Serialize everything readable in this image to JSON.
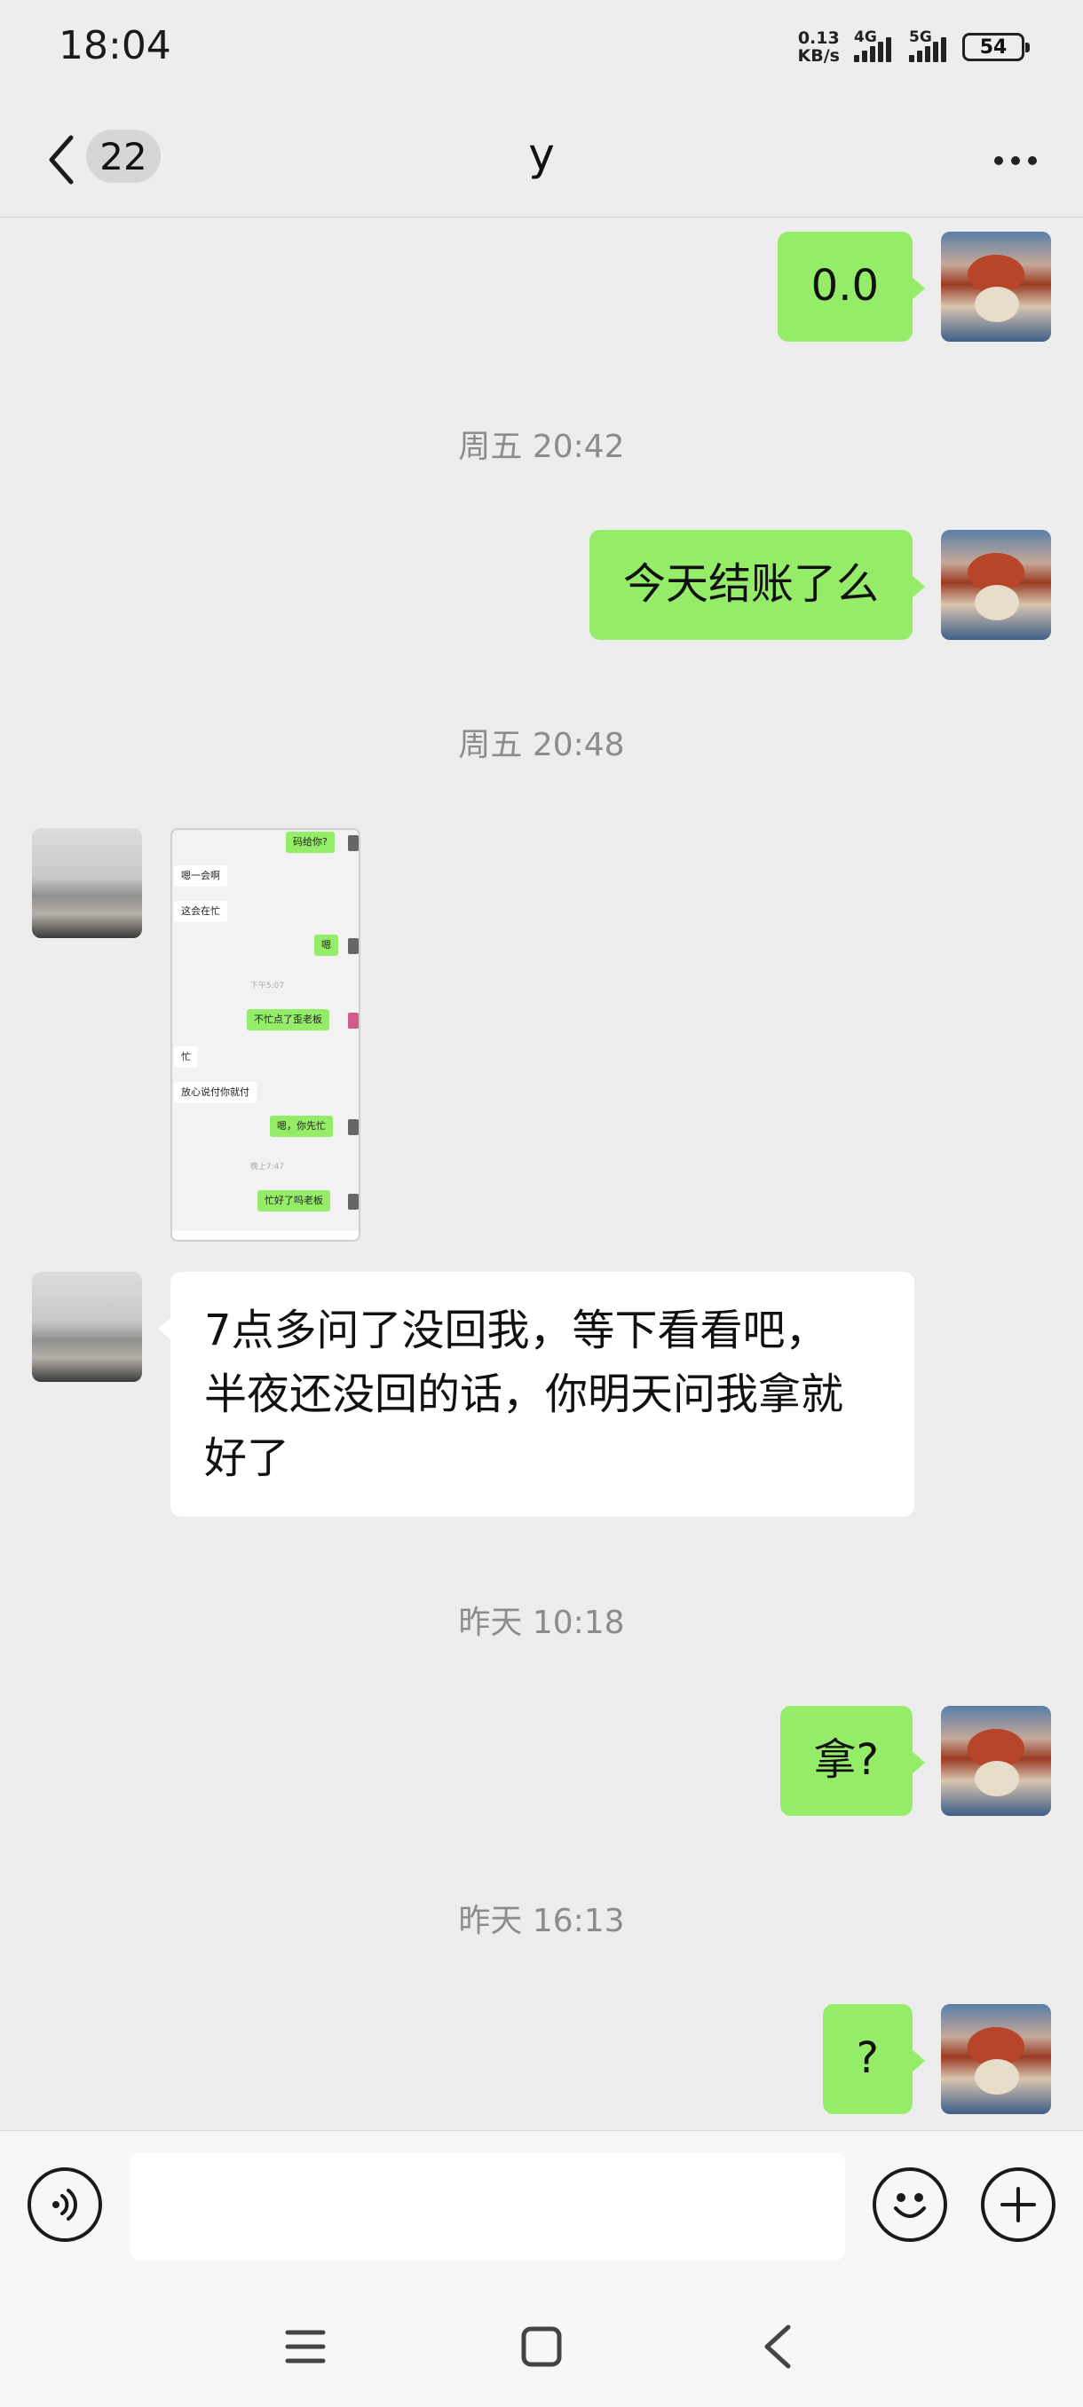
{
  "status_bar": {
    "time": "18:04",
    "net_speed_value": "0.13",
    "net_speed_unit": "KB/s",
    "signal_1": "4G",
    "signal_2": "5G",
    "battery": "54"
  },
  "header": {
    "unread_count": "22",
    "title": "y"
  },
  "messages": [
    {
      "side": "self",
      "type": "text",
      "text": "0.0"
    },
    {
      "type": "timestamp",
      "text": "周五 20:42"
    },
    {
      "side": "self",
      "type": "text",
      "text": "今天结账了么"
    },
    {
      "type": "timestamp",
      "text": "周五 20:48"
    },
    {
      "side": "other",
      "type": "image",
      "screenshot": {
        "items": [
          "码给你?",
          "嗯一会啊",
          "这会在忙",
          "嗯",
          "下午5:07",
          "不忙点了歪老板",
          "忙",
          "放心说付你就付",
          "嗯，你先忙",
          "晚上7:47",
          "忙好了吗老板"
        ]
      }
    },
    {
      "side": "other",
      "type": "text",
      "lines": [
        "7点多问了没回我，等下看看吧，",
        "半夜还没回的话，你明天问我拿就",
        "好了"
      ]
    },
    {
      "type": "timestamp",
      "text": "昨天 10:18"
    },
    {
      "side": "self",
      "type": "text",
      "text": "拿?"
    },
    {
      "type": "timestamp",
      "text": "昨天 16:13"
    },
    {
      "side": "self",
      "type": "text",
      "text": "?"
    }
  ],
  "colors": {
    "self_bubble": "#95ec69",
    "other_bubble": "#ffffff",
    "background": "#ededed"
  },
  "icons": {
    "back": "chevron-left-icon",
    "more": "more-dots-icon",
    "voice": "voice-icon",
    "emoji": "emoji-icon",
    "plus": "plus-icon",
    "menu": "menu-icon",
    "home": "home-icon",
    "sys_back": "sys-back-icon"
  }
}
